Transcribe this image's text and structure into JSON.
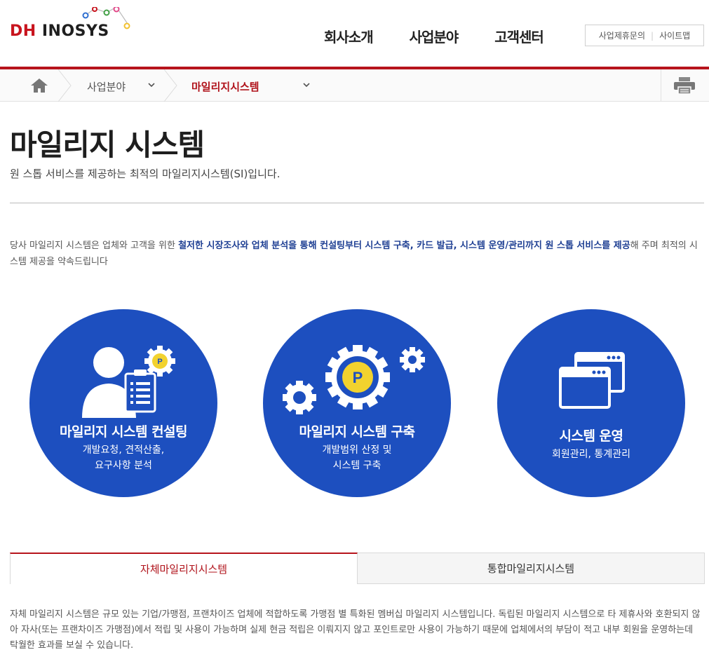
{
  "logo": {
    "part1": "DH",
    "part2": "INOSYS"
  },
  "gnb": {
    "items": [
      "회사소개",
      "사업분야",
      "고객센터"
    ]
  },
  "util": {
    "partner": "사업제휴문의",
    "sitemap": "사이트맵"
  },
  "location": {
    "level1": "사업분야",
    "level2": "마일리지시스템"
  },
  "page": {
    "title": "마일리지 시스템",
    "subtitle": "원 스톱 서비스를 제공하는 최적의 마일리지시스템(SI)입니다."
  },
  "intro": {
    "before": "당사 마일리지 시스템은 업체와 고객을 위한 ",
    "highlight": "철저한 시장조사와 업체 분석을 통해 컨설팅부터 시스템 구축, 카드 발급, 시스템 운영/관리까지 원 스톱 서비스를 제공",
    "after": "해 주며 최적의 시스템 제공을 약속드립니다"
  },
  "services": [
    {
      "title": "마일리지 시스템 컨설팅",
      "desc": "개발요청, 견적산출,\n요구사항 분석",
      "icon": "consulting-icon"
    },
    {
      "title": "마일리지 시스템 구축",
      "desc": "개발범위 산정 및\n시스템 구축",
      "icon": "gears-icon"
    },
    {
      "title": "시스템 운영",
      "desc": "회원관리, 통계관리",
      "icon": "windows-icon"
    }
  ],
  "tabs": [
    "자체마일리지시스템",
    "통합마일리지시스템"
  ],
  "description": "자체 마일리지 시스템은 규모 있는 기업/가맹점, 프랜차이즈 업체에 적합하도록 가맹점 별 특화된 멤버십 마일리지 시스템입니다. 독립된 마일리지 시스템으로 타 제휴사와 호환되지 않아 자사(또는 프랜차이즈 가맹점)에서 적립 및 사용이 가능하며 실제 현금 적립은 이뤄지지 않고 포인트로만 사용이 가능하기 때문에 업체에서의 부담이 적고 내부 회원을 운영하는데 탁월한 효과를 보실 수 있습니다.",
  "colors": {
    "brand_red": "#b7141c",
    "circle_blue": "#1d4fbf",
    "highlight_blue": "#1e3f93",
    "coin_yellow": "#f2d22e"
  }
}
